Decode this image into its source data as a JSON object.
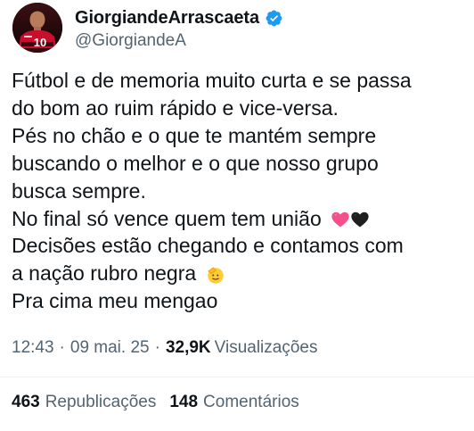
{
  "author": {
    "display_name": "GiorgiandeArrascaeta",
    "handle": "@GiorgiandeA",
    "verified": true,
    "avatar_icon": "profile-photo-flamengo-player",
    "avatar_jersey_number": "10"
  },
  "tweet": {
    "lines": [
      {
        "text": "Fútbol e de memoria muito curta e se passa",
        "emojis": []
      },
      {
        "text": "do bom ao ruim rápido e vice-versa.",
        "emojis": []
      },
      {
        "text": "Pés no chão e o que te mantém sempre",
        "emojis": []
      },
      {
        "text": "buscando o melhor e o que nosso grupo",
        "emojis": []
      },
      {
        "text": "busca sempre.",
        "emojis": []
      },
      {
        "text": "No final só vence quem tem união ",
        "emojis": [
          "pink-heart-emoji",
          "black-heart-emoji"
        ]
      },
      {
        "text": "Decisões estão chegando e contamos com",
        "emojis": []
      },
      {
        "text": "a nação rubro negra ",
        "emojis": [
          "saluting-face-emoji"
        ]
      },
      {
        "text": "Pra cima meu mengao",
        "emojis": []
      }
    ]
  },
  "meta": {
    "time": "12:43",
    "separator": "·",
    "date": "09 mai. 25",
    "views_count": "32,9K",
    "views_label": "Visualizações"
  },
  "stats": {
    "reposts_count": "463",
    "reposts_label": "Republicações",
    "comments_count": "148",
    "comments_label": "Comentários"
  },
  "colors": {
    "text": "#0f1419",
    "secondary": "#536471",
    "verified_badge": "#1d9bf0",
    "divider": "#eff3f4"
  }
}
